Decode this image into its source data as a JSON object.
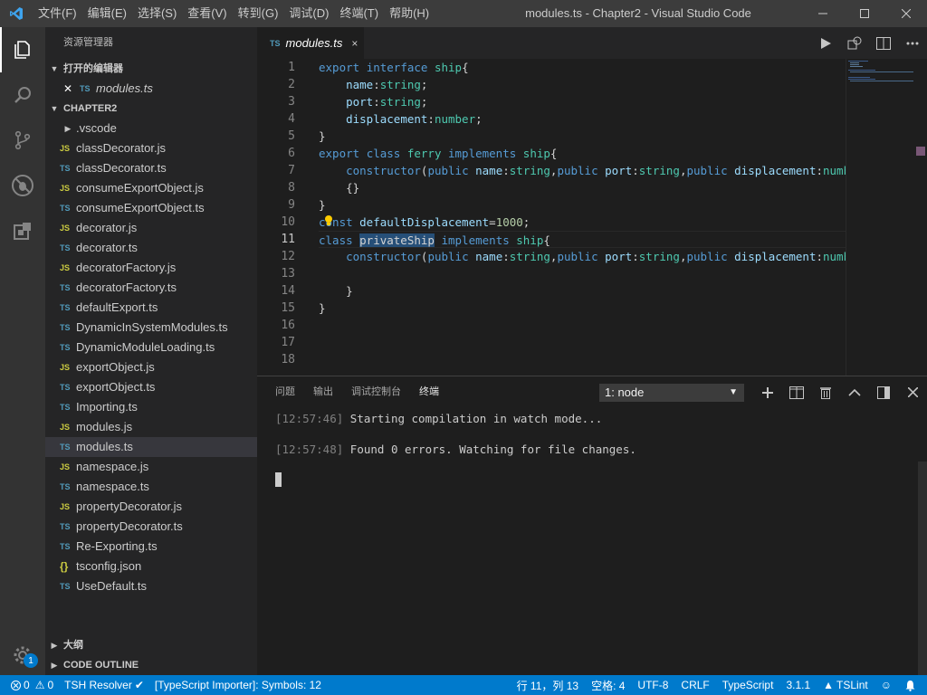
{
  "window": {
    "title": "modules.ts - Chapter2 - Visual Studio Code",
    "menu": [
      "文件(F)",
      "编辑(E)",
      "选择(S)",
      "查看(V)",
      "转到(G)",
      "调试(D)",
      "终端(T)",
      "帮助(H)"
    ]
  },
  "activity_bar": {
    "items": [
      "explorer-icon",
      "search-icon",
      "source-control-icon",
      "debug-icon",
      "extensions-icon"
    ],
    "settings_badge": "1"
  },
  "sidebar": {
    "title": "资源管理器",
    "open_editors_header": "打开的编辑器",
    "open_editor": {
      "icon": "TS",
      "label": "modules.ts"
    },
    "folder_header": "CHAPTER2",
    "files": [
      {
        "icon": "",
        "label": ".vscode",
        "kind": "folder"
      },
      {
        "icon": "JS",
        "label": "classDecorator.js",
        "kind": "js"
      },
      {
        "icon": "TS",
        "label": "classDecorator.ts",
        "kind": "ts"
      },
      {
        "icon": "JS",
        "label": "consumeExportObject.js",
        "kind": "js"
      },
      {
        "icon": "TS",
        "label": "consumeExportObject.ts",
        "kind": "ts"
      },
      {
        "icon": "JS",
        "label": "decorator.js",
        "kind": "js"
      },
      {
        "icon": "TS",
        "label": "decorator.ts",
        "kind": "ts"
      },
      {
        "icon": "JS",
        "label": "decoratorFactory.js",
        "kind": "js"
      },
      {
        "icon": "TS",
        "label": "decoratorFactory.ts",
        "kind": "ts"
      },
      {
        "icon": "TS",
        "label": "defaultExport.ts",
        "kind": "ts"
      },
      {
        "icon": "TS",
        "label": "DynamicInSystemModules.ts",
        "kind": "ts"
      },
      {
        "icon": "TS",
        "label": "DynamicModuleLoading.ts",
        "kind": "ts"
      },
      {
        "icon": "JS",
        "label": "exportObject.js",
        "kind": "js"
      },
      {
        "icon": "TS",
        "label": "exportObject.ts",
        "kind": "ts"
      },
      {
        "icon": "TS",
        "label": "Importing.ts",
        "kind": "ts"
      },
      {
        "icon": "JS",
        "label": "modules.js",
        "kind": "js"
      },
      {
        "icon": "TS",
        "label": "modules.ts",
        "kind": "ts",
        "selected": true
      },
      {
        "icon": "JS",
        "label": "namespace.js",
        "kind": "js"
      },
      {
        "icon": "TS",
        "label": "namespace.ts",
        "kind": "ts"
      },
      {
        "icon": "JS",
        "label": "propertyDecorator.js",
        "kind": "js"
      },
      {
        "icon": "TS",
        "label": "propertyDecorator.ts",
        "kind": "ts"
      },
      {
        "icon": "TS",
        "label": "Re-Exporting.ts",
        "kind": "ts"
      },
      {
        "icon": "{}",
        "label": "tsconfig.json",
        "kind": "json"
      },
      {
        "icon": "TS",
        "label": "UseDefault.ts",
        "kind": "ts"
      }
    ],
    "outline_header": "大纲",
    "code_outline_header": "CODE OUTLINE"
  },
  "editor": {
    "tab": {
      "icon": "TS",
      "label": "modules.ts",
      "close": "×"
    },
    "current_line": 11,
    "line_numbers": [
      "1",
      "2",
      "3",
      "4",
      "5",
      "6",
      "7",
      "8",
      "9",
      "10",
      "11",
      "12",
      "13",
      "14",
      "15",
      "16",
      "17",
      "18"
    ],
    "lines": [
      [
        [
          "kw",
          "export "
        ],
        [
          "kw",
          "interface "
        ],
        [
          "ty",
          "ship"
        ],
        [
          "pl",
          "{"
        ]
      ],
      [
        [
          "pl",
          "    "
        ],
        [
          "pr",
          "name"
        ],
        [
          "pl",
          ":"
        ],
        [
          "ty",
          "string"
        ],
        [
          "pl",
          ";"
        ]
      ],
      [
        [
          "pl",
          "    "
        ],
        [
          "pr",
          "port"
        ],
        [
          "pl",
          ":"
        ],
        [
          "ty",
          "string"
        ],
        [
          "pl",
          ";"
        ]
      ],
      [
        [
          "pl",
          "    "
        ],
        [
          "pr",
          "displacement"
        ],
        [
          "pl",
          ":"
        ],
        [
          "ty",
          "number"
        ],
        [
          "pl",
          ";"
        ]
      ],
      [
        [
          "pl",
          "}"
        ]
      ],
      [
        [
          "kw",
          "export "
        ],
        [
          "kw",
          "class "
        ],
        [
          "ty",
          "ferry "
        ],
        [
          "kw",
          "implements "
        ],
        [
          "ty",
          "ship"
        ],
        [
          "pl",
          "{"
        ]
      ],
      [
        [
          "pl",
          "    "
        ],
        [
          "kw",
          "constructor"
        ],
        [
          "pl",
          "("
        ],
        [
          "kw",
          "public "
        ],
        [
          "pr",
          "name"
        ],
        [
          "pl",
          ":"
        ],
        [
          "ty",
          "string"
        ],
        [
          "pl",
          ","
        ],
        [
          "kw",
          "public "
        ],
        [
          "pr",
          "port"
        ],
        [
          "pl",
          ":"
        ],
        [
          "ty",
          "string"
        ],
        [
          "pl",
          ","
        ],
        [
          "kw",
          "public "
        ],
        [
          "pr",
          "displacement"
        ],
        [
          "pl",
          ":"
        ],
        [
          "ty",
          "number"
        ],
        [
          "pl",
          "){"
        ]
      ],
      [
        [
          "pl",
          "    {}"
        ]
      ],
      [
        [
          "pl",
          "}"
        ]
      ],
      [
        [
          "kw",
          "const "
        ],
        [
          "pr",
          "defaultDisplacement"
        ],
        [
          "pl",
          "="
        ],
        [
          "nm",
          "1000"
        ],
        [
          "pl",
          ";"
        ]
      ],
      [
        [
          "kw",
          "class "
        ],
        [
          "hl",
          "privateShip"
        ],
        [
          "pl",
          " "
        ],
        [
          "kw",
          "implements "
        ],
        [
          "ty",
          "ship"
        ],
        [
          "pl",
          "{"
        ]
      ],
      [
        [
          "pl",
          "    "
        ],
        [
          "kw",
          "constructor"
        ],
        [
          "pl",
          "("
        ],
        [
          "kw",
          "public "
        ],
        [
          "pr",
          "name"
        ],
        [
          "pl",
          ":"
        ],
        [
          "ty",
          "string"
        ],
        [
          "pl",
          ","
        ],
        [
          "kw",
          "public "
        ],
        [
          "pr",
          "port"
        ],
        [
          "pl",
          ":"
        ],
        [
          "ty",
          "string"
        ],
        [
          "pl",
          ","
        ],
        [
          "kw",
          "public "
        ],
        [
          "pr",
          "displacement"
        ],
        [
          "pl",
          ":"
        ],
        [
          "ty",
          "number"
        ],
        [
          "pl",
          "){"
        ]
      ],
      [
        [
          "pl",
          ""
        ]
      ],
      [
        [
          "pl",
          "    }"
        ]
      ],
      [
        [
          "pl",
          "}"
        ]
      ],
      [
        [
          "pl",
          ""
        ]
      ],
      [
        [
          "pl",
          ""
        ]
      ],
      [
        [
          "pl",
          ""
        ]
      ]
    ]
  },
  "panel": {
    "tabs": [
      "问题",
      "输出",
      "调试控制台",
      "终端"
    ],
    "active_tab": "终端",
    "terminal_select": "1: node",
    "terminal_lines": [
      {
        "time": "[12:57:46]",
        "text": " Starting compilation in watch mode..."
      },
      {
        "time": "[12:57:48]",
        "text": " Found 0 errors. Watching for file changes."
      }
    ]
  },
  "status_bar": {
    "errors": "0",
    "warnings": "0",
    "tsh_resolver": "TSH Resolver",
    "importer": "[TypeScript Importer]: Symbols: 12",
    "position": "行 11，列 13",
    "spaces": "空格: 4",
    "encoding": "UTF-8",
    "eol": "CRLF",
    "language": "TypeScript",
    "ts_version": "3.1.1",
    "tslint": "TSLint"
  },
  "colors": {
    "status_bar": "#007acc",
    "keyword": "#569cd6",
    "type": "#4ec9b0",
    "property": "#9cdcfe",
    "number": "#b5cea8"
  }
}
